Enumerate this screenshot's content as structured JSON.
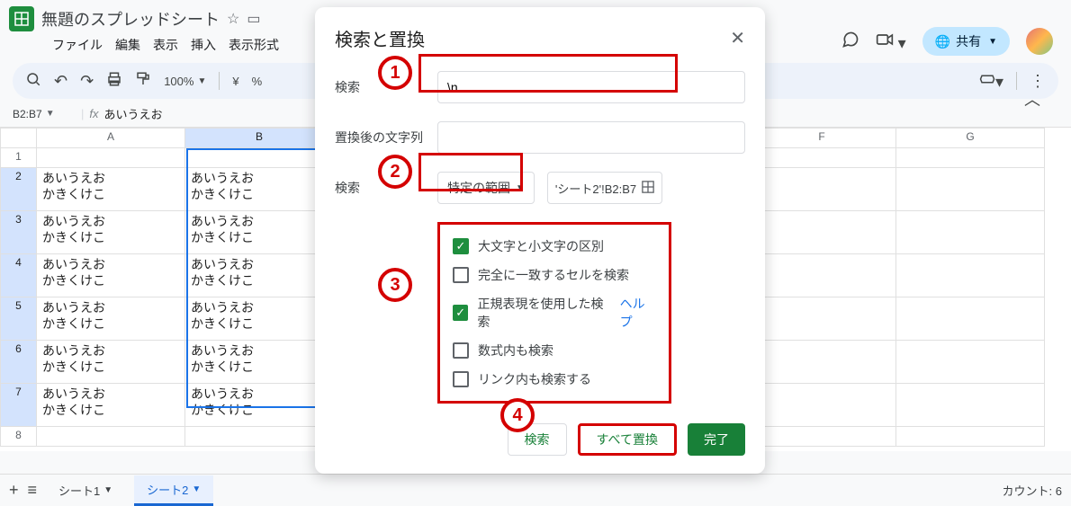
{
  "header": {
    "doc_title": "無題のスプレッドシート",
    "menus": [
      "ファイル",
      "編集",
      "表示",
      "挿入",
      "表示形式"
    ],
    "share_label": "共有"
  },
  "toolbar": {
    "zoom": "100%",
    "currency": "¥",
    "percent": "%"
  },
  "fx": {
    "cell_ref": "B2:B7",
    "formula_value": "あいうえお"
  },
  "grid": {
    "col_headers": [
      "A",
      "B",
      "F",
      "G"
    ],
    "rows": [
      {
        "n": "1",
        "a": "",
        "b": ""
      },
      {
        "n": "2",
        "a": "あいうえお\nかきくけこ",
        "b": "あいうえお\nかきくけこ"
      },
      {
        "n": "3",
        "a": "あいうえお\nかきくけこ",
        "b": "あいうえお\nかきくけこ"
      },
      {
        "n": "4",
        "a": "あいうえお\nかきくけこ",
        "b": "あいうえお\nかきくけこ"
      },
      {
        "n": "5",
        "a": "あいうえお\nかきくけこ",
        "b": "あいうえお\nかきくけこ"
      },
      {
        "n": "6",
        "a": "あいうえお\nかきくけこ",
        "b": "あいうえお\nかきくけこ"
      },
      {
        "n": "7",
        "a": "あいうえお\nかきくけこ",
        "b": "あいうえお\nかきくけこ"
      },
      {
        "n": "8",
        "a": "",
        "b": ""
      }
    ]
  },
  "tabs": {
    "add": "+",
    "list": "≡",
    "items": [
      {
        "label": "シート1",
        "active": false
      },
      {
        "label": "シート2",
        "active": true
      }
    ],
    "count_label": "カウント: 6"
  },
  "dialog": {
    "title": "検索と置換",
    "find_label": "検索",
    "find_value": "\\n",
    "replace_label": "置換後の文字列",
    "replace_value": "",
    "scope_label": "検索",
    "scope_value": "特定の範囲",
    "range_value": "'シート2'!B2:B7",
    "checks": [
      {
        "label": "大文字と小文字の区別",
        "checked": true
      },
      {
        "label": "完全に一致するセルを検索",
        "checked": false
      },
      {
        "label": "正規表現を使用した検索",
        "checked": true,
        "help": "ヘルプ"
      },
      {
        "label": "数式内も検索",
        "checked": false
      },
      {
        "label": "リンク内も検索する",
        "checked": false
      }
    ],
    "btn_find": "検索",
    "btn_replace_all": "すべて置換",
    "btn_done": "完了"
  },
  "annotations": {
    "n1": "1",
    "n2": "2",
    "n3": "3",
    "n4": "4"
  }
}
